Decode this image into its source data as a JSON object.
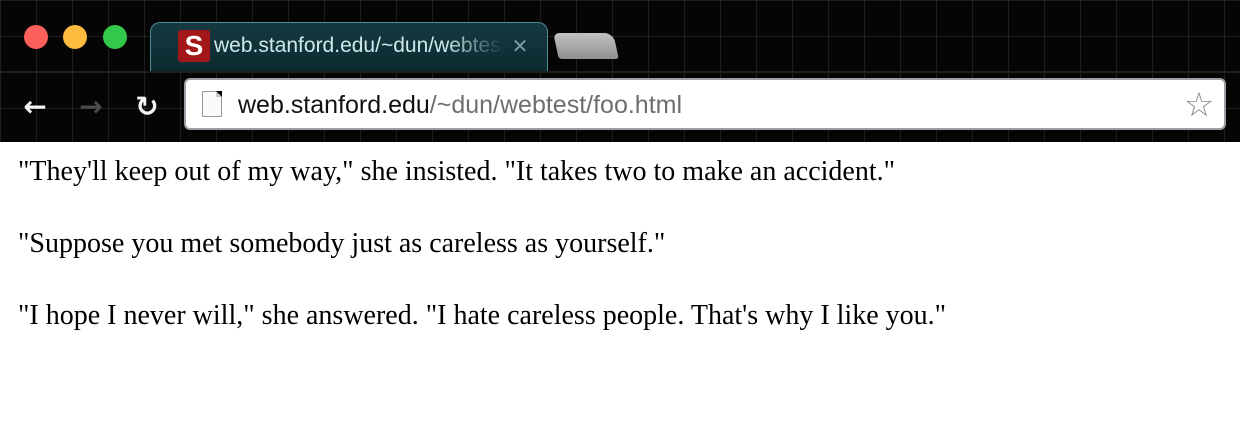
{
  "window": {
    "controls": [
      "close",
      "minimize",
      "maximize"
    ],
    "colors": {
      "close": "#fc605b",
      "minimize": "#fdbc40",
      "maximize": "#34c84a"
    }
  },
  "tab": {
    "favicon_letter": "S",
    "favicon_color": "#a3171b",
    "title": "web.stanford.edu/~dun/webtest/foo.html",
    "close_glyph": "✕"
  },
  "toolbar": {
    "back_glyph": "←",
    "forward_glyph": "→",
    "reload_glyph": "↻"
  },
  "omnibox": {
    "url_host": "web.stanford.edu",
    "url_path": "/~dun/webtest/foo.html",
    "page_icon": "page-icon",
    "star_glyph": "☆"
  },
  "content": {
    "paragraphs": [
      "\"They'll keep out of my way,\" she insisted. \"It takes two to make an accident.\"",
      "\"Suppose you met somebody just as careless as yourself.\"",
      "\"I hope I never will,\" she answered. \"I hate careless people. That's why I like you.\""
    ]
  }
}
